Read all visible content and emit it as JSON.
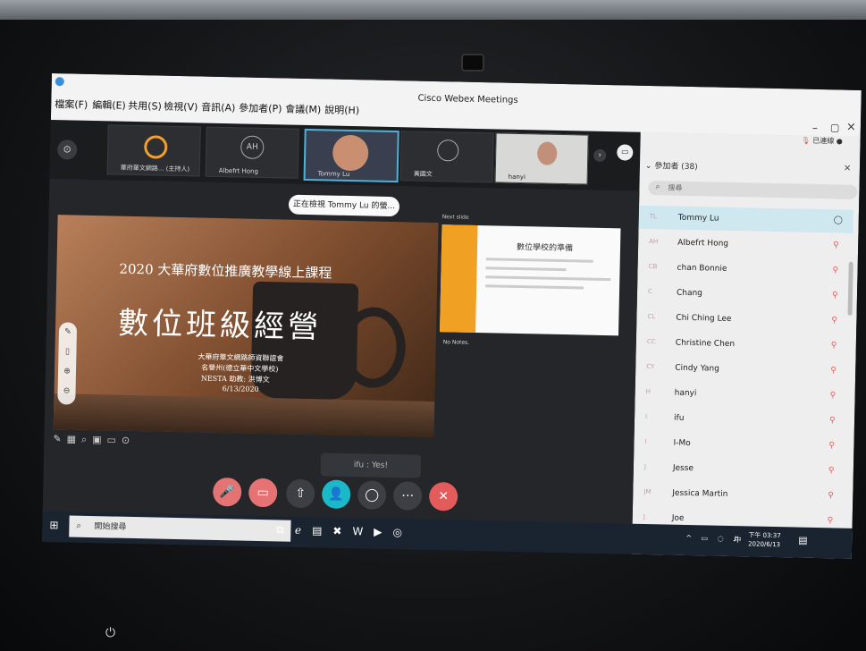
{
  "app": {
    "title": "Cisco Webex Meetings"
  },
  "menu": [
    {
      "label": "檔案(F)"
    },
    {
      "label": "編輯(E)"
    },
    {
      "label": "共用(S)"
    },
    {
      "label": "檢視(V)"
    },
    {
      "label": "音訊(A)"
    },
    {
      "label": "參加者(P)"
    },
    {
      "label": "會議(M)"
    },
    {
      "label": "說明(H)"
    }
  ],
  "window_controls": {
    "minimize": "–",
    "maximize": "▢",
    "close": "×"
  },
  "video_strip": [
    {
      "name": "華府華文網路... (主持人)"
    },
    {
      "name": "Albefrt Hong",
      "initials": "AH"
    },
    {
      "name": "Tommy Lu"
    },
    {
      "name": "黃國文"
    },
    {
      "name": "hanyi"
    }
  ],
  "connection": {
    "label": "已連線"
  },
  "participants": {
    "header": "參加者 (38)",
    "search_placeholder": "搜尋",
    "list": [
      {
        "initials": "TL",
        "name": "Tommy Lu"
      },
      {
        "initials": "AH",
        "name": "Albefrt Hong"
      },
      {
        "initials": "CB",
        "name": "chan Bonnie"
      },
      {
        "initials": "C",
        "name": "Chang"
      },
      {
        "initials": "CL",
        "name": "Chi Ching Lee"
      },
      {
        "initials": "CC",
        "name": "Christine Chen"
      },
      {
        "initials": "CY",
        "name": "Cindy Yang"
      },
      {
        "initials": "H",
        "name": "hanyi"
      },
      {
        "initials": "I",
        "name": "ifu"
      },
      {
        "initials": "I",
        "name": "I-Mo"
      },
      {
        "initials": "J",
        "name": "Jesse"
      },
      {
        "initials": "JM",
        "name": "Jessica Martin"
      },
      {
        "initials": "J",
        "name": "Joe"
      }
    ]
  },
  "banner": {
    "text": "正在檢視 Tommy Lu 的螢..."
  },
  "slide": {
    "line1": "2020 大華府數位推廣教學線上課程",
    "line2": "數位班級經營",
    "line3": "大華府華文網路師資聯誼會",
    "line4": "名譽州(德立華中文學校)",
    "line5": "NESTA 助教: 洪博文",
    "line6": "6/13/2020"
  },
  "next_slide": {
    "label": "Next slide",
    "title": "數位學校的準備"
  },
  "notes": {
    "text": "No Notes."
  },
  "chat": {
    "text": "ifu : Yes!"
  },
  "taskbar": {
    "search_placeholder": "開始搜尋",
    "time": "下午 03:37",
    "date": "2020/6/13",
    "ime": "中"
  },
  "colors": {
    "end_red": "#e35b5b",
    "accent_teal": "#1ab8c8",
    "mic_red": "#e57373"
  }
}
